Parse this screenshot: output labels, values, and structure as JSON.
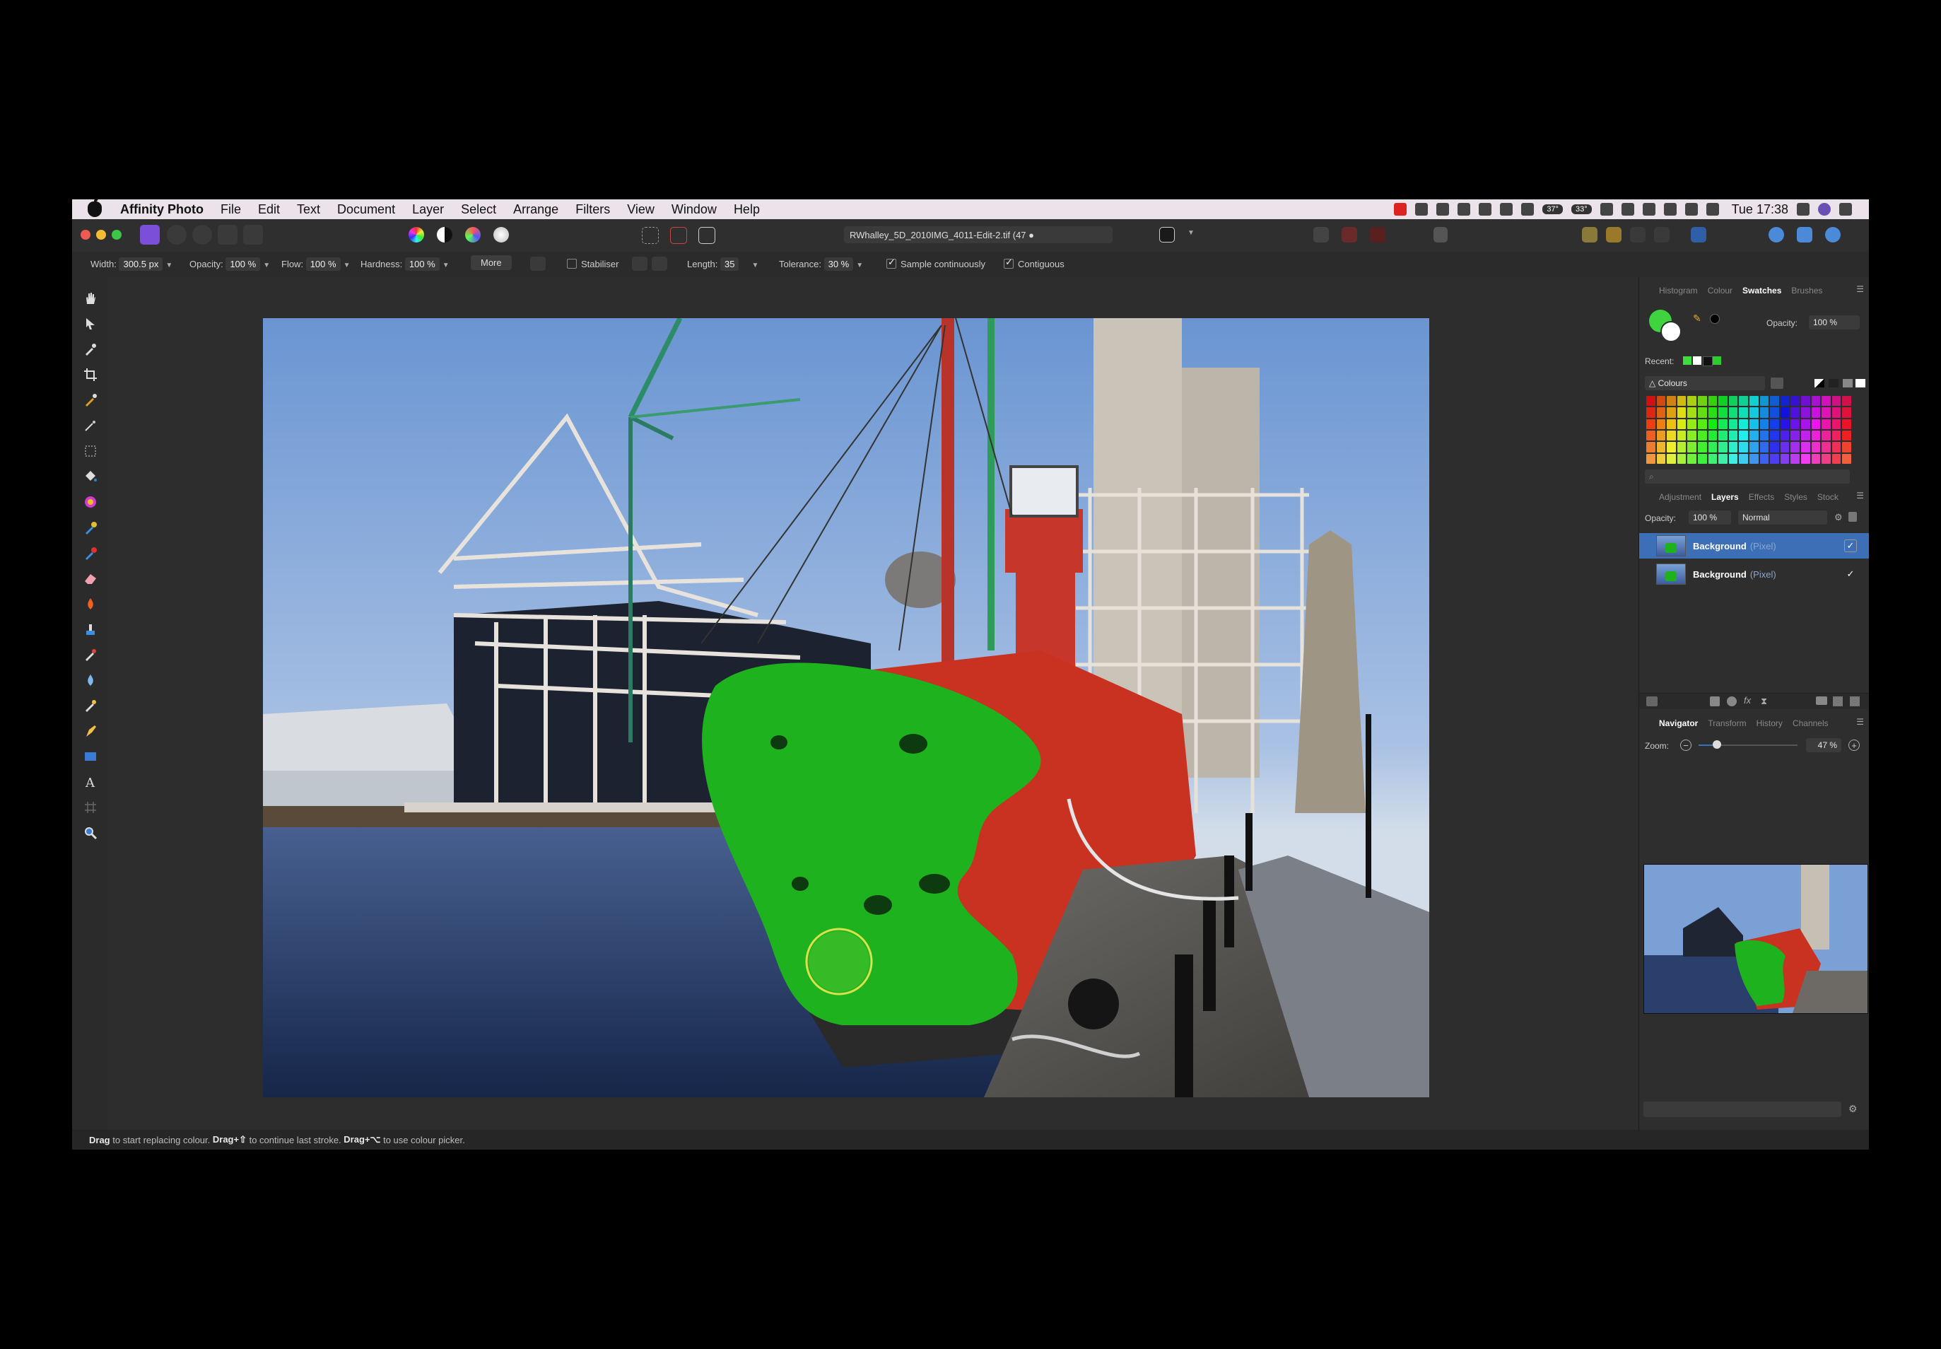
{
  "menubar": {
    "app_name": "Affinity Photo",
    "menus": [
      "File",
      "Edit",
      "Text",
      "Document",
      "Layer",
      "Select",
      "Arrange",
      "Filters",
      "View",
      "Window",
      "Help"
    ],
    "status_pills": [
      "37°",
      "33°"
    ],
    "clock": "Tue 17:38"
  },
  "toolbar": {
    "document_tab": "RWhalley_5D_2010IMG_4011-Edit-2.tif (47 ●"
  },
  "context_bar": {
    "width_label": "Width:",
    "width_value": "300.5 px",
    "opacity_label": "Opacity:",
    "opacity_value": "100 %",
    "flow_label": "Flow:",
    "flow_value": "100 %",
    "hardness_label": "Hardness:",
    "hardness_value": "100 %",
    "more_label": "More",
    "stabiliser_label": "Stabiliser",
    "length_label": "Length:",
    "length_value": "35",
    "tolerance_label": "Tolerance:",
    "tolerance_value": "30 %",
    "sample_continuously_label": "Sample continuously",
    "sample_continuously_checked": true,
    "contiguous_label": "Contiguous",
    "contiguous_checked": true
  },
  "swatches_panel": {
    "tabs": [
      "Histogram",
      "Colour",
      "Swatches",
      "Brushes"
    ],
    "active_tab": "Swatches",
    "opacity_label": "Opacity:",
    "opacity_value": "100 %",
    "recent_label": "Recent:",
    "recent_colors": [
      "#3fdc3f",
      "#ffffff",
      "#111111",
      "#2fcc2f"
    ],
    "palette_name": "Colours",
    "primary_color": "#3fd43f",
    "secondary_color": "#ffffff"
  },
  "layers_panel": {
    "tabs": [
      "Adjustment",
      "Layers",
      "Effects",
      "Styles",
      "Stock"
    ],
    "active_tab": "Layers",
    "opacity_label": "Opacity:",
    "opacity_value": "100 %",
    "blend_mode": "Normal",
    "layers": [
      {
        "name": "Background",
        "type": "(Pixel)",
        "selected": true,
        "visible": true
      },
      {
        "name": "Background",
        "type": "(Pixel)",
        "selected": false,
        "visible": true
      }
    ]
  },
  "navigator_panel": {
    "tabs": [
      "Navigator",
      "Transform",
      "History",
      "Channels"
    ],
    "active_tab": "Navigator",
    "zoom_label": "Zoom:",
    "zoom_value": "47 %"
  },
  "statusbar": {
    "part1_bold": "Drag",
    "part1_text": " to start replacing colour. ",
    "part2_bold": "Drag+⇧",
    "part2_text": " to continue last stroke. ",
    "part3_bold": "Drag+⌥",
    "part3_text": " to use colour picker."
  },
  "colors": {
    "accent": "#3c6fb5",
    "replacement_green": "#1fb21f",
    "hull_red": "#c83322"
  }
}
